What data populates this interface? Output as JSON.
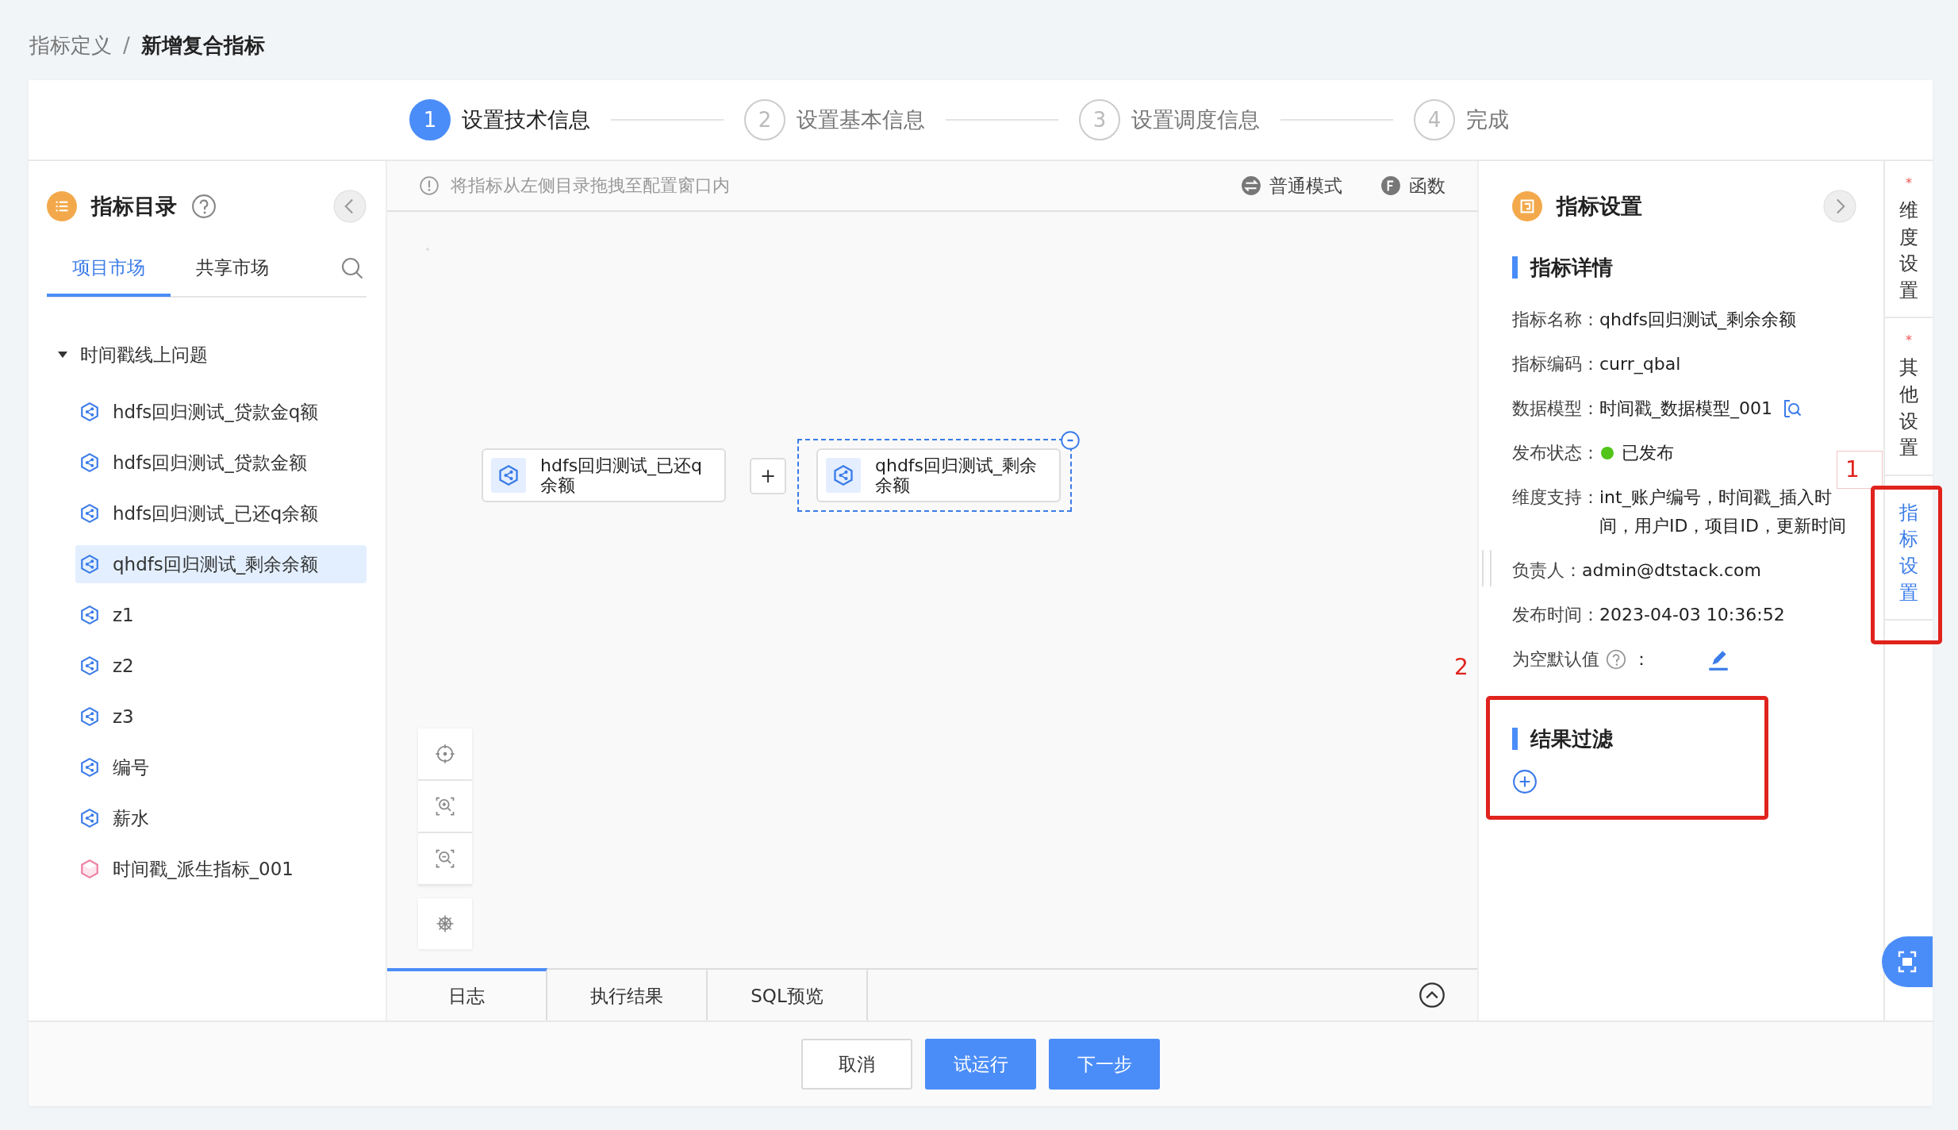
{
  "breadcrumb": {
    "items": [
      {
        "label": "指标定义"
      },
      {
        "label": "新增复合指标"
      }
    ],
    "separator": "/"
  },
  "steps": [
    {
      "number": "1",
      "label": "设置技术信息",
      "selected": true
    },
    {
      "number": "2",
      "label": "设置基本信息",
      "selected": false
    },
    {
      "number": "3",
      "label": "设置调度信息",
      "selected": false
    },
    {
      "number": "4",
      "label": "完成",
      "selected": false
    }
  ],
  "catalog": {
    "title": "指标目录",
    "tabs": [
      {
        "label": "项目市场",
        "selected": true
      },
      {
        "label": "共享市场",
        "selected": false
      }
    ],
    "tree": {
      "label": "时间戳线上问题",
      "expanded": true,
      "children": [
        {
          "label": "hdfs回归测试_贷款金q额",
          "kind": "composite",
          "selected": false
        },
        {
          "label": "hdfs回归测试_贷款金额",
          "kind": "composite",
          "selected": false
        },
        {
          "label": "hdfs回归测试_已还q余额",
          "kind": "composite",
          "selected": false
        },
        {
          "label": "qhdfs回归测试_剩余余额",
          "kind": "composite",
          "selected": true
        },
        {
          "label": "z1",
          "kind": "composite",
          "selected": false
        },
        {
          "label": "z2",
          "kind": "composite",
          "selected": false
        },
        {
          "label": "z3",
          "kind": "composite",
          "selected": false
        },
        {
          "label": "编号",
          "kind": "composite",
          "selected": false
        },
        {
          "label": "薪水",
          "kind": "composite",
          "selected": false
        },
        {
          "label": "时间戳_派生指标_001",
          "kind": "derived",
          "selected": false
        }
      ]
    }
  },
  "canvas": {
    "hint": "将指标从左侧目录拖拽至配置窗口内",
    "modes": [
      {
        "label": "普通模式",
        "kind": "switch"
      },
      {
        "label": "函数",
        "kind": "function"
      }
    ],
    "nodes": [
      {
        "label": "hdfs回归测试_已还q余额",
        "selected": false
      },
      {
        "label": "qhdfs回归测试_剩余余额",
        "selected": true
      }
    ],
    "operator": "+"
  },
  "bottom_tabs": [
    {
      "label": "日志",
      "selected": true
    },
    {
      "label": "执行结果",
      "selected": false
    },
    {
      "label": "SQL预览",
      "selected": false
    }
  ],
  "settings": {
    "title": "指标设置",
    "section_title": "指标详情",
    "fields": [
      {
        "kind": "text",
        "label": "指标名称：",
        "value": "qhdfs回归测试_剩余余额"
      },
      {
        "kind": "text",
        "label": "指标编码：",
        "value": "curr_qbal"
      },
      {
        "kind": "model",
        "label": "数据模型：",
        "value": "时间戳_数据模型_001"
      },
      {
        "kind": "status",
        "label": "发布状态：",
        "value": "已发布",
        "color": "#52c41a"
      },
      {
        "kind": "text",
        "label": "维度支持：",
        "value": "int_账户编号，时间戳_插入时间，用户ID，项目ID，更新时间"
      },
      {
        "kind": "text",
        "label": "负责人：",
        "value": "admin@dtstack.com"
      },
      {
        "kind": "text",
        "label": "发布时间：",
        "value": "2023-04-03 10:36:52"
      },
      {
        "kind": "default",
        "label": "为空默认值",
        "value": "："
      }
    ],
    "filter_title": "结果过滤"
  },
  "side_tabs": [
    {
      "label": "维度设置",
      "mark": "*",
      "selected": false
    },
    {
      "label": "其他设置",
      "mark": "*",
      "selected": false
    },
    {
      "label": "指标设置",
      "selected": true
    }
  ],
  "buttons": [
    {
      "label": "取消",
      "kind": "default"
    },
    {
      "label": "试运行",
      "kind": "primary"
    },
    {
      "label": "下一步",
      "kind": "primary"
    }
  ],
  "annotations": [
    {
      "label": "1",
      "kind": "boxed"
    },
    {
      "label": "2",
      "kind": "plain"
    }
  ]
}
